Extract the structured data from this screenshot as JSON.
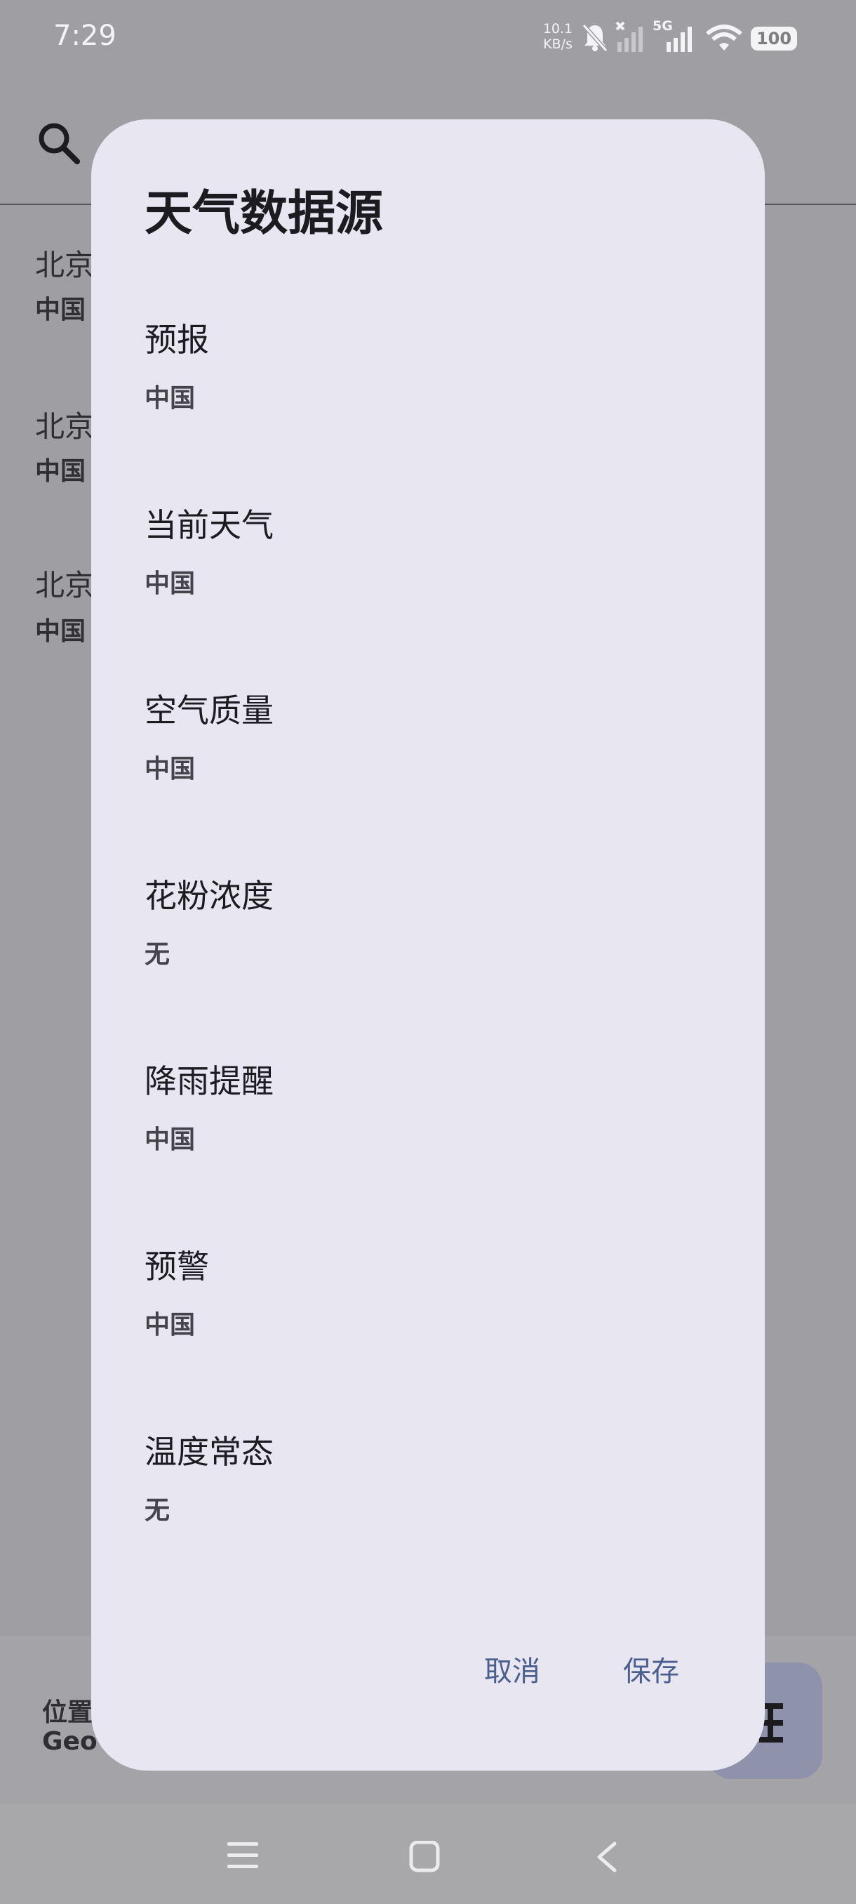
{
  "status_bar": {
    "time": "7:29",
    "net_speed_value": "10.1",
    "net_speed_unit": "KB/s",
    "network_type": "5G",
    "battery": "100"
  },
  "background": {
    "cities": [
      {
        "name": "北京",
        "country": "中国"
      },
      {
        "name": "北京",
        "country": "中国"
      },
      {
        "name": "北京",
        "country": "中国"
      }
    ],
    "location_label": "位置",
    "location_value": "Geo"
  },
  "dialog": {
    "title": "天气数据源",
    "rows": [
      {
        "label": "预报",
        "value": "中国"
      },
      {
        "label": "当前天气",
        "value": "中国"
      },
      {
        "label": "空气质量",
        "value": "中国"
      },
      {
        "label": "花粉浓度",
        "value": "无"
      },
      {
        "label": "降雨提醒",
        "value": "中国"
      },
      {
        "label": "预警",
        "value": "中国"
      },
      {
        "label": "温度常态",
        "value": "无"
      }
    ],
    "cancel_label": "取消",
    "save_label": "保存"
  },
  "colors": {
    "accent": "#4b5f8f",
    "dialog_bg": "#e8e6f0",
    "scrim": "#9e9ea3"
  }
}
